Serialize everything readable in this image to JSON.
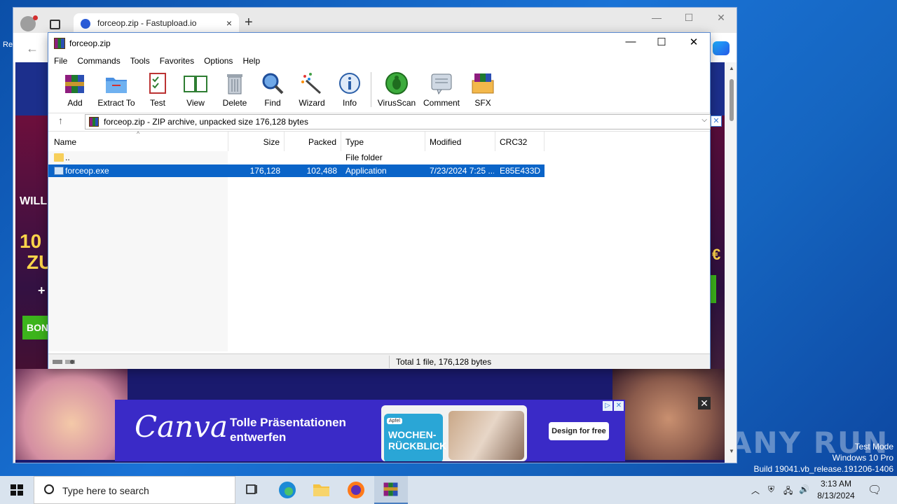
{
  "browser": {
    "tab_title": "forceop.zip - Fastupload.io",
    "tab_close": "×",
    "new_tab": "+",
    "minimize": "—",
    "maximize": "☐",
    "close": "✕"
  },
  "site": {
    "left_promo_1": "WILL",
    "left_promo_2": "10",
    "left_promo_3": "ZU",
    "left_promo_4": "+",
    "bonus_label": "BON",
    "right_promo": "€"
  },
  "ad": {
    "logo": "Canva",
    "headline": "Tolle Präsentationen entwerfen",
    "card_tag": "Apfel",
    "card_title": "WOCHEN-\nRÜCKBLICK",
    "cta": "Design for free",
    "close": "✕"
  },
  "rar": {
    "title": "forceop.zip",
    "menu": [
      "File",
      "Commands",
      "Tools",
      "Favorites",
      "Options",
      "Help"
    ],
    "toolbar": [
      {
        "label": "Add",
        "icon": "add-icon"
      },
      {
        "label": "Extract To",
        "icon": "extract-icon"
      },
      {
        "label": "Test",
        "icon": "test-icon"
      },
      {
        "label": "View",
        "icon": "view-icon"
      },
      {
        "label": "Delete",
        "icon": "delete-icon"
      },
      {
        "label": "Find",
        "icon": "find-icon"
      },
      {
        "label": "Wizard",
        "icon": "wizard-icon"
      },
      {
        "label": "Info",
        "icon": "info-icon"
      },
      {
        "label": "VirusScan",
        "icon": "virusscan-icon"
      },
      {
        "label": "Comment",
        "icon": "comment-icon"
      },
      {
        "label": "SFX",
        "icon": "sfx-icon"
      }
    ],
    "address": "forceop.zip - ZIP archive, unpacked size 176,128 bytes",
    "columns": [
      "Name",
      "Size",
      "Packed",
      "Type",
      "Modified",
      "CRC32"
    ],
    "rows": [
      {
        "name": "..",
        "size": "",
        "packed": "",
        "type": "File folder",
        "modified": "",
        "crc": ""
      },
      {
        "name": "forceop.exe",
        "size": "176,128",
        "packed": "102,488",
        "type": "Application",
        "modified": "7/23/2024 7:25 ...",
        "crc": "E85E433D"
      }
    ],
    "status": "Total 1 file, 176,128 bytes"
  },
  "taskbar": {
    "search_placeholder": "Type here to search",
    "time": "3:13 AM",
    "date": "8/13/2024"
  },
  "watermark": {
    "brand": "ANY RUN",
    "line1": "Test Mode",
    "line2": "Windows 10 Pro",
    "line3": "Build 19041.vb_release.191206-1406"
  },
  "desktop": {
    "edge_text": "Re"
  },
  "colors": {
    "selection": "#0a64c8",
    "desktop": "#1a73d6",
    "ad_bg": "#3a2ac7"
  }
}
